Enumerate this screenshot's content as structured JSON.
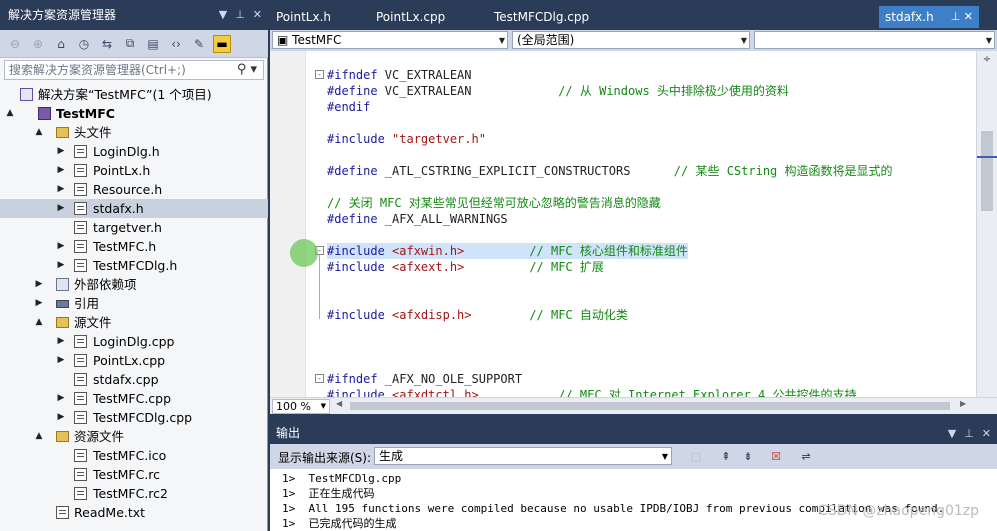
{
  "solution_explorer": {
    "title": "解决方案资源管理器",
    "search_placeholder": "搜索解决方案资源管理器(Ctrl+;)",
    "tree": [
      {
        "label": "解决方案“TestMFC”(1 个项目)",
        "icon": "solution-icon",
        "level": 0,
        "expander": "",
        "selected": false
      },
      {
        "label": "TestMFC",
        "icon": "project-icon",
        "level": 0,
        "expander": "▲",
        "selected": false,
        "bold": true
      },
      {
        "label": "头文件",
        "icon": "folder-icon",
        "level": 1,
        "expander": "▲",
        "selected": false
      },
      {
        "label": "LoginDlg.h",
        "icon": "file-icon",
        "level": 2,
        "expander": "▶",
        "selected": false
      },
      {
        "label": "PointLx.h",
        "icon": "file-icon",
        "level": 2,
        "expander": "▶",
        "selected": false
      },
      {
        "label": "Resource.h",
        "icon": "file-icon",
        "level": 2,
        "expander": "▶",
        "selected": false
      },
      {
        "label": "stdafx.h",
        "icon": "file-icon",
        "level": 2,
        "expander": "▶",
        "selected": true
      },
      {
        "label": "targetver.h",
        "icon": "file-icon",
        "level": 2,
        "expander": "",
        "selected": false
      },
      {
        "label": "TestMFC.h",
        "icon": "file-icon",
        "level": 2,
        "expander": "▶",
        "selected": false
      },
      {
        "label": "TestMFCDlg.h",
        "icon": "file-icon",
        "level": 2,
        "expander": "▶",
        "selected": false
      },
      {
        "label": "外部依赖项",
        "icon": "external-deps-icon",
        "level": 1,
        "expander": "▶",
        "selected": false
      },
      {
        "label": "引用",
        "icon": "references-icon",
        "level": 1,
        "expander": "▶",
        "selected": false
      },
      {
        "label": "源文件",
        "icon": "folder-icon",
        "level": 1,
        "expander": "▲",
        "selected": false
      },
      {
        "label": "LoginDlg.cpp",
        "icon": "file-icon",
        "level": 2,
        "expander": "▶",
        "selected": false
      },
      {
        "label": "PointLx.cpp",
        "icon": "file-icon",
        "level": 2,
        "expander": "▶",
        "selected": false
      },
      {
        "label": "stdafx.cpp",
        "icon": "file-icon",
        "level": 2,
        "expander": "",
        "selected": false
      },
      {
        "label": "TestMFC.cpp",
        "icon": "file-icon",
        "level": 2,
        "expander": "▶",
        "selected": false
      },
      {
        "label": "TestMFCDlg.cpp",
        "icon": "file-icon",
        "level": 2,
        "expander": "▶",
        "selected": false
      },
      {
        "label": "资源文件",
        "icon": "folder-icon",
        "level": 1,
        "expander": "▲",
        "selected": false
      },
      {
        "label": "TestMFC.ico",
        "icon": "file-icon",
        "level": 2,
        "expander": "",
        "selected": false
      },
      {
        "label": "TestMFC.rc",
        "icon": "file-icon",
        "level": 2,
        "expander": "",
        "selected": false
      },
      {
        "label": "TestMFC.rc2",
        "icon": "file-icon",
        "level": 2,
        "expander": "",
        "selected": false
      },
      {
        "label": "ReadMe.txt",
        "icon": "file-icon",
        "level": 1,
        "expander": "",
        "selected": false
      }
    ]
  },
  "editor": {
    "tabs": [
      {
        "label": "PointLx.h",
        "active": false
      },
      {
        "label": "PointLx.cpp",
        "active": false
      },
      {
        "label": "TestMFCDlg.cpp",
        "active": false
      },
      {
        "label": "stdafx.h",
        "active": true
      }
    ],
    "nav": {
      "project": "TestMFC",
      "scope": "(全局范围)",
      "member": ""
    },
    "zoom": "100 %",
    "lines": [
      {
        "parts": [
          [
            "pp",
            "#ifndef "
          ],
          [
            "df",
            "VC_EXTRALEAN"
          ]
        ],
        "fold": "-"
      },
      {
        "parts": [
          [
            "pp",
            "#define "
          ],
          [
            "df",
            "VC_EXTRALEAN"
          ],
          [
            "df",
            "            "
          ],
          [
            "cm",
            "// 从 Windows 头中排除极少使用的资料"
          ]
        ]
      },
      {
        "parts": [
          [
            "pp",
            "#endif"
          ]
        ]
      },
      {
        "parts": []
      },
      {
        "parts": [
          [
            "pp",
            "#include "
          ],
          [
            "str",
            "\"targetver.h\""
          ]
        ]
      },
      {
        "parts": []
      },
      {
        "parts": [
          [
            "pp",
            "#define "
          ],
          [
            "df",
            "_ATL_CSTRING_EXPLICIT_CONSTRUCTORS"
          ],
          [
            "df",
            "      "
          ],
          [
            "cm",
            "// 某些 CString 构造函数将是显式的"
          ]
        ]
      },
      {
        "parts": []
      },
      {
        "parts": [
          [
            "cm",
            "// 关闭 MFC 对某些常见但经常可放心忽略的警告消息的隐藏"
          ]
        ]
      },
      {
        "parts": [
          [
            "pp",
            "#define "
          ],
          [
            "df",
            "_AFX_ALL_WARNINGS"
          ]
        ]
      },
      {
        "parts": []
      },
      {
        "parts": [
          [
            "pp",
            "#include "
          ],
          [
            "str",
            "<afxwin.h>"
          ],
          [
            "df",
            "         "
          ],
          [
            "cm",
            "// MFC 核心组件和标准组件"
          ]
        ],
        "fold": "-",
        "highlight": true
      },
      {
        "parts": [
          [
            "pp",
            "#include "
          ],
          [
            "str",
            "<afxext.h>"
          ],
          [
            "df",
            "         "
          ],
          [
            "cm",
            "// MFC 扩展"
          ]
        ]
      },
      {
        "parts": []
      },
      {
        "parts": []
      },
      {
        "parts": [
          [
            "pp",
            "#include "
          ],
          [
            "str",
            "<afxdisp.h>"
          ],
          [
            "df",
            "        "
          ],
          [
            "cm",
            "// MFC 自动化类"
          ]
        ]
      },
      {
        "parts": []
      },
      {
        "parts": []
      },
      {
        "parts": []
      },
      {
        "parts": [
          [
            "pp",
            "#ifndef "
          ],
          [
            "df",
            "_AFX_NO_OLE_SUPPORT"
          ]
        ],
        "fold": "-"
      },
      {
        "parts": [
          [
            "pp",
            "#include "
          ],
          [
            "str",
            "<afxdtctl.h>"
          ],
          [
            "df",
            "           "
          ],
          [
            "cm",
            "// MFC 对 Internet Explorer 4 公共控件的支持"
          ]
        ]
      }
    ]
  },
  "output": {
    "title": "输出",
    "source_label": "显示输出来源(S):",
    "source_value": "生成",
    "lines": [
      "1>  TestMFCDlg.cpp",
      "1>  正在生成代码",
      "1>  All 195 functions were compiled because no usable IPDB/IOBJ from previous compilation was found.",
      "1>  已完成代码的生成"
    ]
  },
  "watermark": "CSDN @zhaopeng01zp"
}
